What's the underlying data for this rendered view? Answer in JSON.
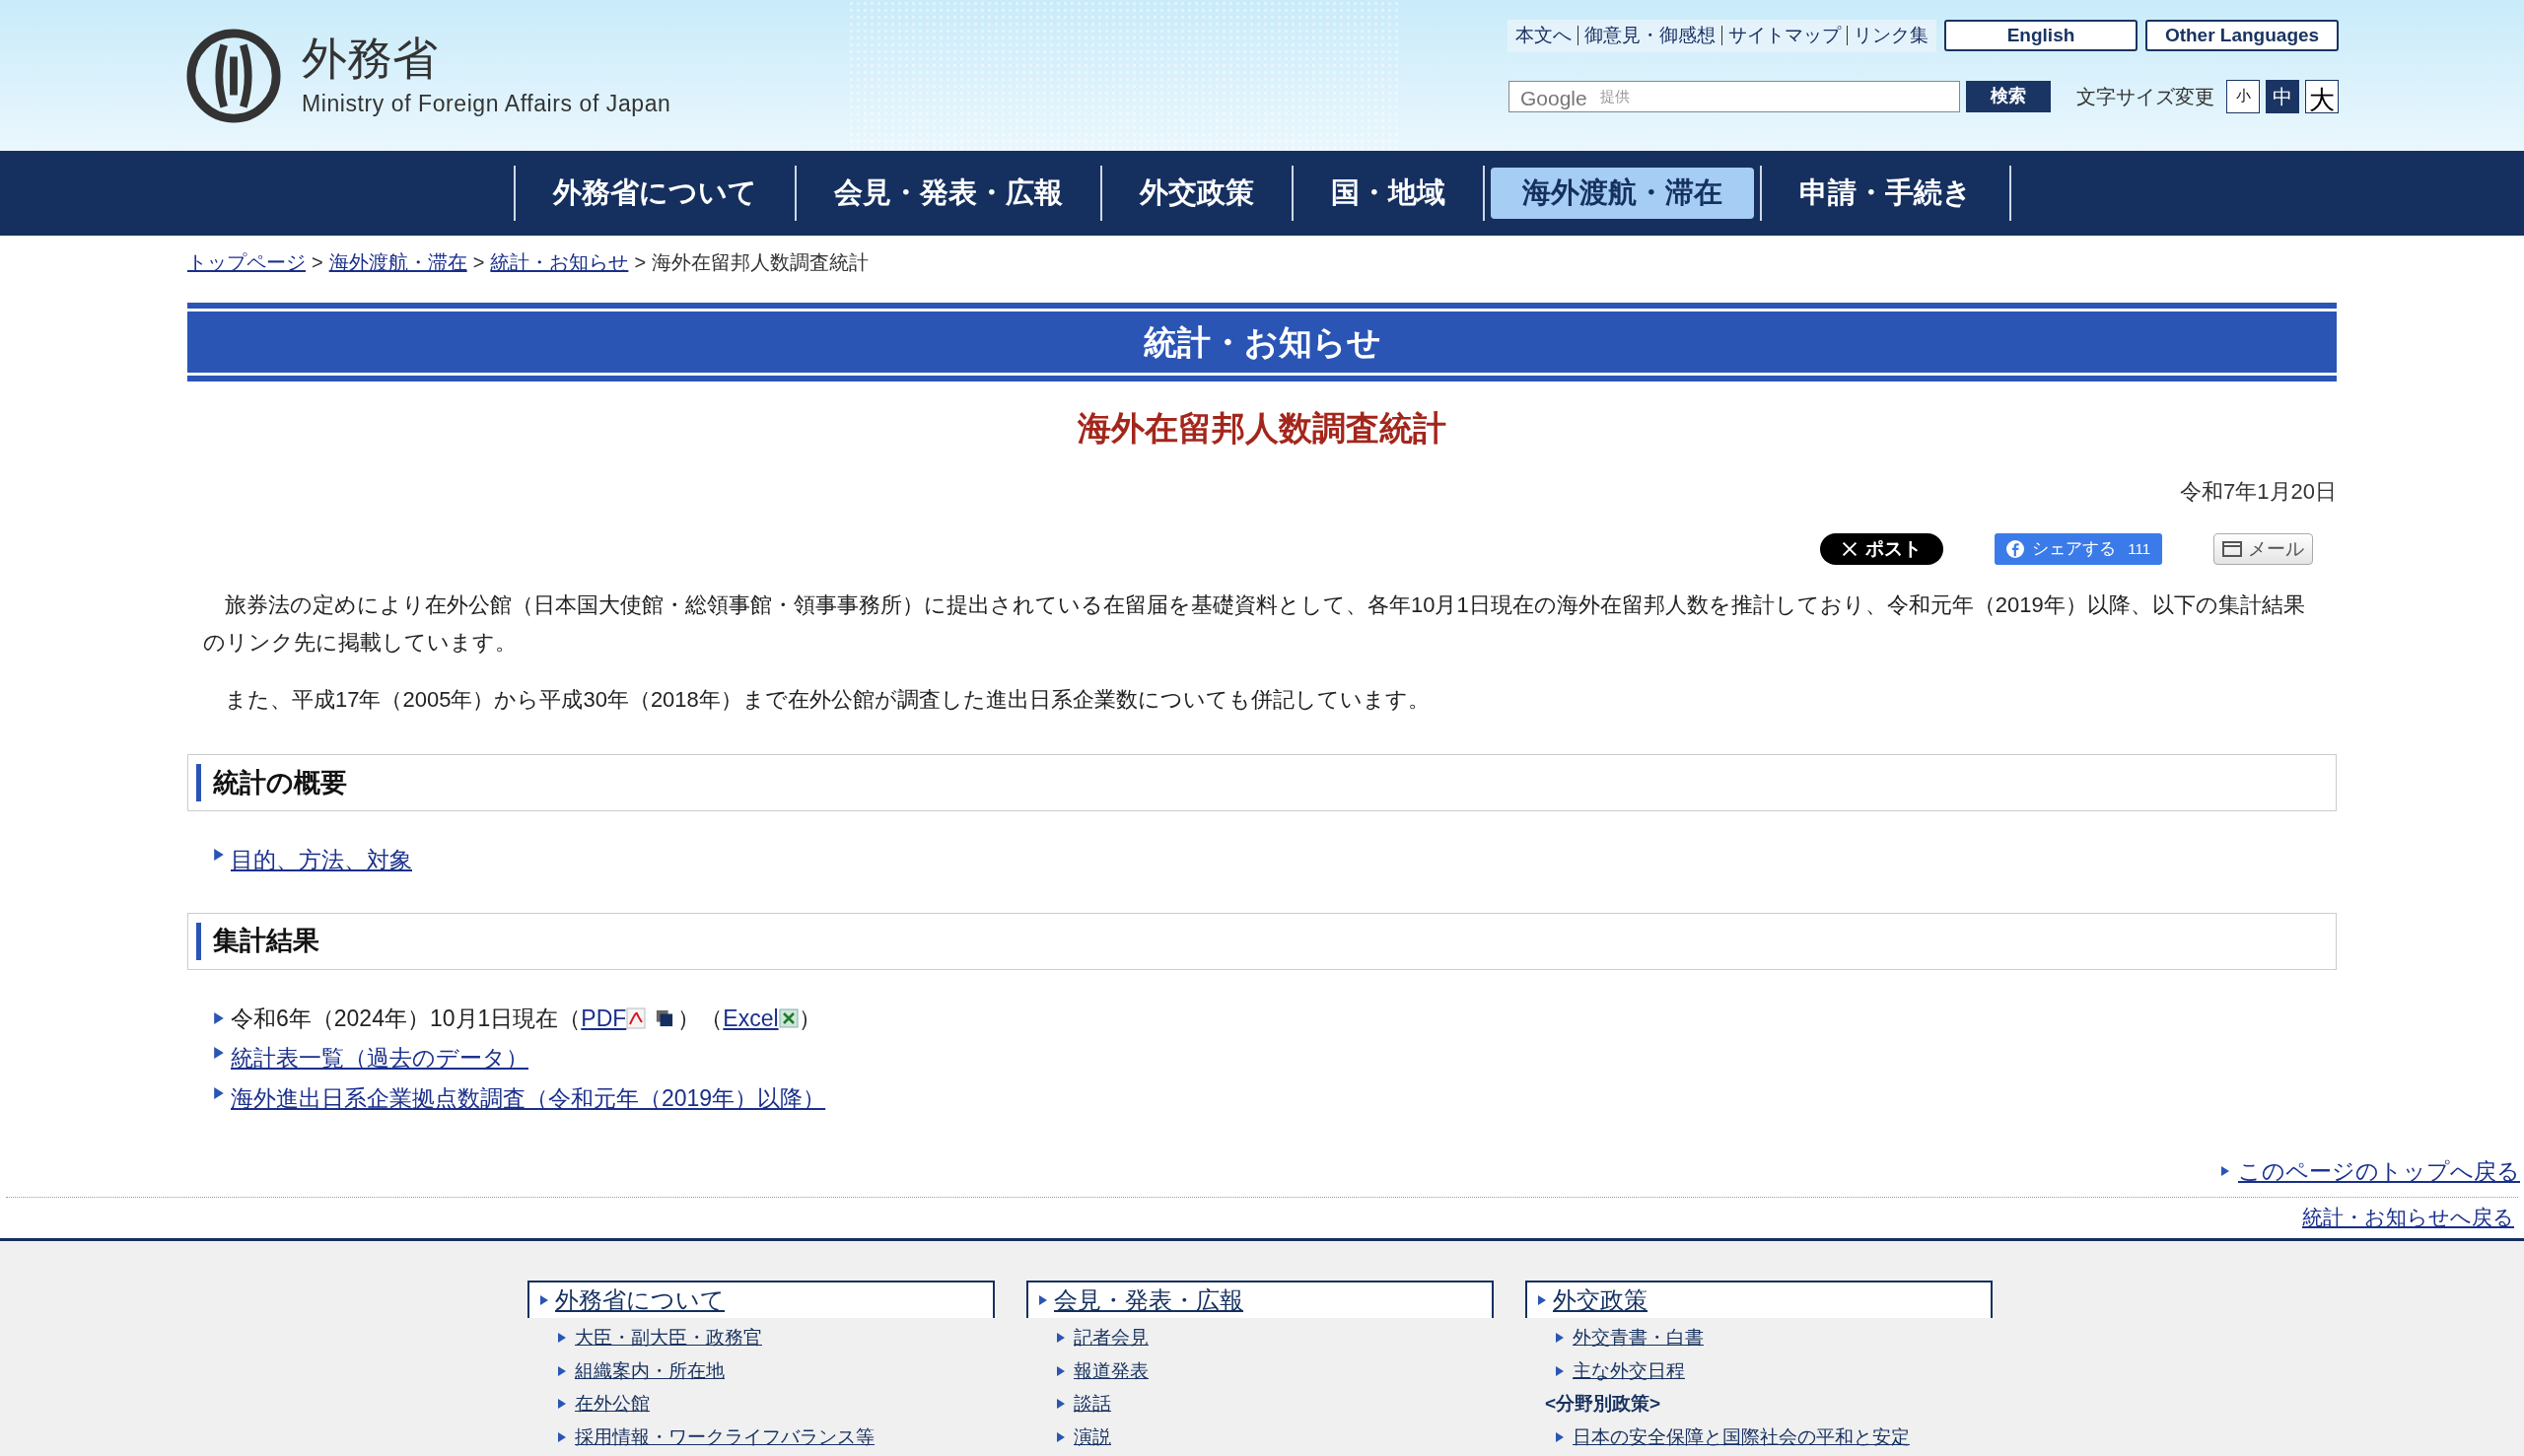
{
  "header": {
    "logo_title": "外務省",
    "logo_subtitle": "Ministry of Foreign Affairs of Japan",
    "utility_links": [
      "本文へ",
      "御意見・御感想",
      "サイトマップ",
      "リンク集"
    ],
    "language_buttons": [
      "English",
      "Other Languages"
    ],
    "search": {
      "brand": "Google",
      "placeholder": "提供",
      "button": "検索"
    },
    "font_size": {
      "label": "文字サイズ変更",
      "options": [
        {
          "label": "小",
          "selected": false
        },
        {
          "label": "中",
          "selected": true
        },
        {
          "label": "大",
          "selected": false
        }
      ]
    }
  },
  "nav": [
    {
      "label": "外務省について",
      "selected": false
    },
    {
      "label": "会見・発表・広報",
      "selected": false
    },
    {
      "label": "外交政策",
      "selected": false
    },
    {
      "label": "国・地域",
      "selected": false
    },
    {
      "label": "海外渡航・滞在",
      "selected": true
    },
    {
      "label": "申請・手続き",
      "selected": false
    }
  ],
  "breadcrumb": {
    "links": [
      "トップページ",
      "海外渡航・滞在",
      "統計・お知らせ"
    ],
    "separator": ">",
    "current": "海外在留邦人数調査統計"
  },
  "section_title": "統計・お知らせ",
  "page_title": "海外在留邦人数調査統計",
  "date": "令和7年1月20日",
  "share": {
    "post": "ポスト",
    "facebook": "シェアする",
    "facebook_count": "111",
    "mail": "メール"
  },
  "paragraphs": [
    "旅券法の定めにより在外公館（日本国大使館・総領事館・領事事務所）に提出されている在留届を基礎資料として、各年10月1日現在の海外在留邦人数を推計しており、令和元年（2019年）以降、以下の集計結果のリンク先に掲載しています。",
    "また、平成17年（2005年）から平成30年（2018年）まで在外公館が調査した進出日系企業数についても併記しています。"
  ],
  "sections": [
    {
      "heading": "統計の概要",
      "items": [
        {
          "kind": "link",
          "text": "目的、方法、対象"
        }
      ]
    },
    {
      "heading": "集計結果",
      "items": [
        {
          "kind": "files",
          "text": "令和6年（2024年）10月1日現在（",
          "pdf": "PDF",
          "mid": "）（",
          "excel": "Excel",
          "end": "）"
        },
        {
          "kind": "link",
          "text": "統計表一覧（過去のデータ）"
        },
        {
          "kind": "link",
          "text": "海外進出日系企業拠点数調査（令和元年（2019年）以降）"
        }
      ]
    }
  ],
  "back_links": [
    "このページのトップへ戻る",
    "統計・お知らせへ戻る"
  ],
  "footer": [
    {
      "title": "外務省について",
      "items": [
        {
          "kind": "link",
          "text": "大臣・副大臣・政務官"
        },
        {
          "kind": "link",
          "text": "組織案内・所在地"
        },
        {
          "kind": "link",
          "text": "在外公館"
        },
        {
          "kind": "link",
          "text": "採用情報・ワークライフバランス等"
        }
      ]
    },
    {
      "title": "会見・発表・広報",
      "items": [
        {
          "kind": "link",
          "text": "記者会見"
        },
        {
          "kind": "link",
          "text": "報道発表"
        },
        {
          "kind": "link",
          "text": "談話"
        },
        {
          "kind": "link",
          "text": "演説"
        }
      ]
    },
    {
      "title": "外交政策",
      "items": [
        {
          "kind": "link",
          "text": "外交青書・白書"
        },
        {
          "kind": "link",
          "text": "主な外交日程"
        },
        {
          "kind": "label",
          "text": "<分野別政策>"
        },
        {
          "kind": "link",
          "text": "日本の安全保障と国際社会の平和と安定"
        }
      ]
    }
  ]
}
